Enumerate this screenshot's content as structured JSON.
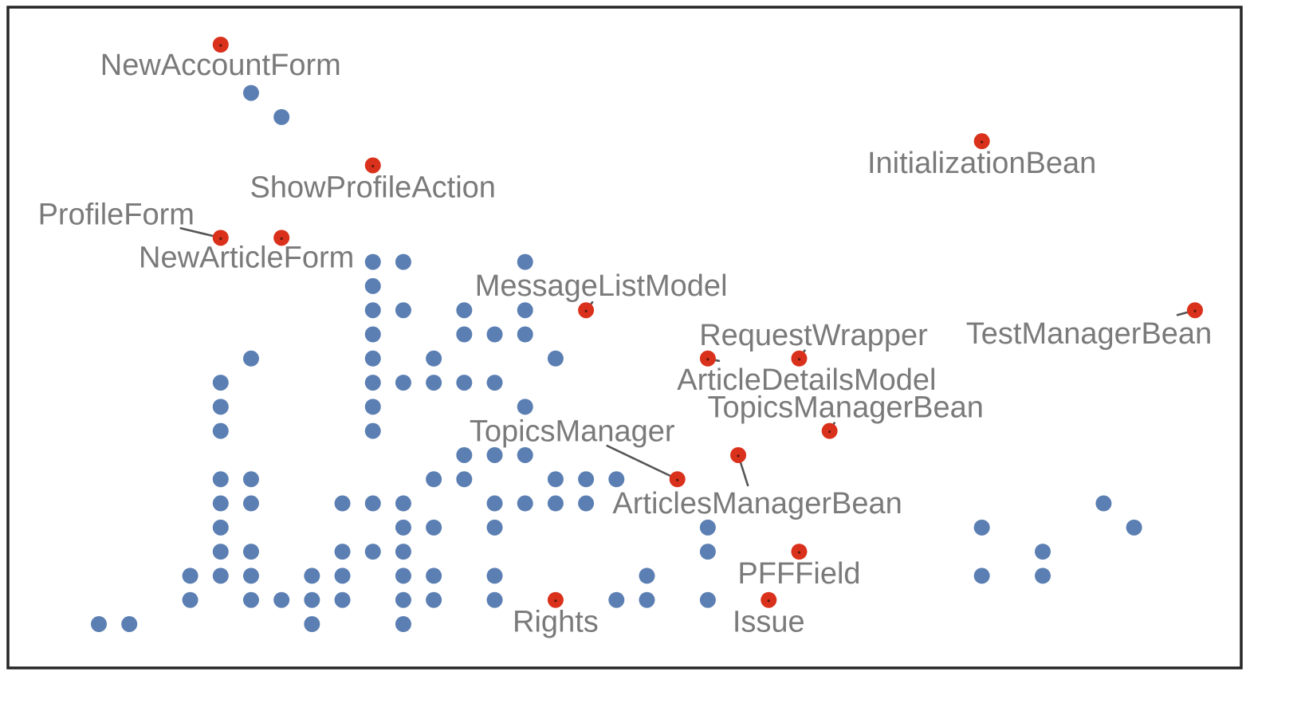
{
  "chart_data": {
    "type": "scatter",
    "title": "",
    "xlabel": "",
    "ylabel": "",
    "grid": false,
    "legend": "none",
    "axes_visible": false,
    "xlim": [
      0,
      36
    ],
    "ylim": [
      0,
      24
    ],
    "y_direction": "top-to-bottom",
    "colors": {
      "unlabeled": "#5b7fb3",
      "labeled": "#d9311b",
      "label_text": "#7a7a7a",
      "frame": "#262626"
    },
    "series": [
      {
        "name": "unlabeled",
        "points": [
          [
            5,
            2
          ],
          [
            6,
            3
          ],
          [
            9,
            9
          ],
          [
            10,
            9
          ],
          [
            14,
            9
          ],
          [
            9,
            10
          ],
          [
            9,
            11
          ],
          [
            10,
            11
          ],
          [
            12,
            11
          ],
          [
            14,
            11
          ],
          [
            9,
            12
          ],
          [
            12,
            12
          ],
          [
            13,
            12
          ],
          [
            14,
            12
          ],
          [
            5,
            13
          ],
          [
            9,
            13
          ],
          [
            11,
            13
          ],
          [
            15,
            13
          ],
          [
            4,
            14
          ],
          [
            9,
            14
          ],
          [
            10,
            14
          ],
          [
            11,
            14
          ],
          [
            12,
            14
          ],
          [
            13,
            14
          ],
          [
            4,
            15
          ],
          [
            9,
            15
          ],
          [
            14,
            15
          ],
          [
            4,
            16
          ],
          [
            9,
            16
          ],
          [
            12,
            17
          ],
          [
            13,
            17
          ],
          [
            14,
            17
          ],
          [
            4,
            18
          ],
          [
            5,
            18
          ],
          [
            11,
            18
          ],
          [
            12,
            18
          ],
          [
            15,
            18
          ],
          [
            16,
            18
          ],
          [
            17,
            18
          ],
          [
            4,
            19
          ],
          [
            5,
            19
          ],
          [
            8,
            19
          ],
          [
            9,
            19
          ],
          [
            10,
            19
          ],
          [
            13,
            19
          ],
          [
            14,
            19
          ],
          [
            15,
            19
          ],
          [
            16,
            19
          ],
          [
            33,
            19
          ],
          [
            4,
            20
          ],
          [
            10,
            20
          ],
          [
            11,
            20
          ],
          [
            13,
            20
          ],
          [
            20,
            20
          ],
          [
            29,
            20
          ],
          [
            34,
            20
          ],
          [
            4,
            21
          ],
          [
            5,
            21
          ],
          [
            8,
            21
          ],
          [
            9,
            21
          ],
          [
            10,
            21
          ],
          [
            20,
            21
          ],
          [
            31,
            21
          ],
          [
            3,
            22
          ],
          [
            4,
            22
          ],
          [
            5,
            22
          ],
          [
            7,
            22
          ],
          [
            8,
            22
          ],
          [
            10,
            22
          ],
          [
            11,
            22
          ],
          [
            13,
            22
          ],
          [
            18,
            22
          ],
          [
            29,
            22
          ],
          [
            31,
            22
          ],
          [
            3,
            23
          ],
          [
            5,
            23
          ],
          [
            6,
            23
          ],
          [
            7,
            23
          ],
          [
            8,
            23
          ],
          [
            10,
            23
          ],
          [
            11,
            23
          ],
          [
            13,
            23
          ],
          [
            17,
            23
          ],
          [
            18,
            23
          ],
          [
            20,
            23
          ],
          [
            0,
            24
          ],
          [
            1,
            24
          ],
          [
            7,
            24
          ],
          [
            10,
            24
          ]
        ]
      },
      {
        "name": "labeled",
        "points": [
          {
            "x": 4,
            "y": 0,
            "label": "NewAccountForm"
          },
          {
            "x": 29,
            "y": 4,
            "label": "InitializationBean"
          },
          {
            "x": 9,
            "y": 5,
            "label": "ShowProfileAction"
          },
          {
            "x": 4,
            "y": 8,
            "label": "ProfileForm"
          },
          {
            "x": 6,
            "y": 8,
            "label": "NewArticleForm"
          },
          {
            "x": 16,
            "y": 11,
            "label": "MessageListModel"
          },
          {
            "x": 36,
            "y": 11,
            "label": "TestManagerBean"
          },
          {
            "x": 20,
            "y": 13,
            "label": "ArticleDetailsModel"
          },
          {
            "x": 23,
            "y": 13,
            "label": "RequestWrapper"
          },
          {
            "x": 24,
            "y": 16,
            "label": "TopicsManagerBean"
          },
          {
            "x": 21,
            "y": 17,
            "label": "ArticlesManagerBean"
          },
          {
            "x": 19,
            "y": 18,
            "label": "TopicsManager"
          },
          {
            "x": 23,
            "y": 21,
            "label": "PFFField"
          },
          {
            "x": 15,
            "y": 23,
            "label": "Rights"
          },
          {
            "x": 22,
            "y": 23,
            "label": "Issue"
          }
        ]
      }
    ],
    "labels": [
      {
        "text": "NewAccountForm",
        "ref": 0,
        "anchor": "below",
        "leader": false
      },
      {
        "text": "InitializationBean",
        "ref": 1,
        "anchor": "below",
        "leader": false
      },
      {
        "text": "ShowProfileAction",
        "ref": 2,
        "anchor": "below",
        "leader": false
      },
      {
        "text": "ProfileForm",
        "ref": 3,
        "anchor": "upper-left",
        "leader": true
      },
      {
        "text": "NewArticleForm",
        "ref": 4,
        "anchor": "below",
        "leader": false
      },
      {
        "text": "MessageListModel",
        "ref": 5,
        "anchor": "above",
        "leader": true
      },
      {
        "text": "TestManagerBean",
        "ref": 6,
        "anchor": "lower-left",
        "leader": true
      },
      {
        "text": "ArticleDetailsModel",
        "ref": 7,
        "anchor": "below",
        "leader": true
      },
      {
        "text": "RequestWrapper",
        "ref": 8,
        "anchor": "above",
        "leader": true
      },
      {
        "text": "TopicsManagerBean",
        "ref": 9,
        "anchor": "above",
        "leader": true
      },
      {
        "text": "ArticlesManagerBean",
        "ref": 10,
        "anchor": "below",
        "leader": true
      },
      {
        "text": "TopicsManager",
        "ref": 11,
        "anchor": "upper-left",
        "leader": true
      },
      {
        "text": "PFFField",
        "ref": 12,
        "anchor": "below",
        "leader": false
      },
      {
        "text": "Rights",
        "ref": 13,
        "anchor": "below",
        "leader": false
      },
      {
        "text": "Issue",
        "ref": 14,
        "anchor": "below",
        "leader": false
      }
    ]
  }
}
